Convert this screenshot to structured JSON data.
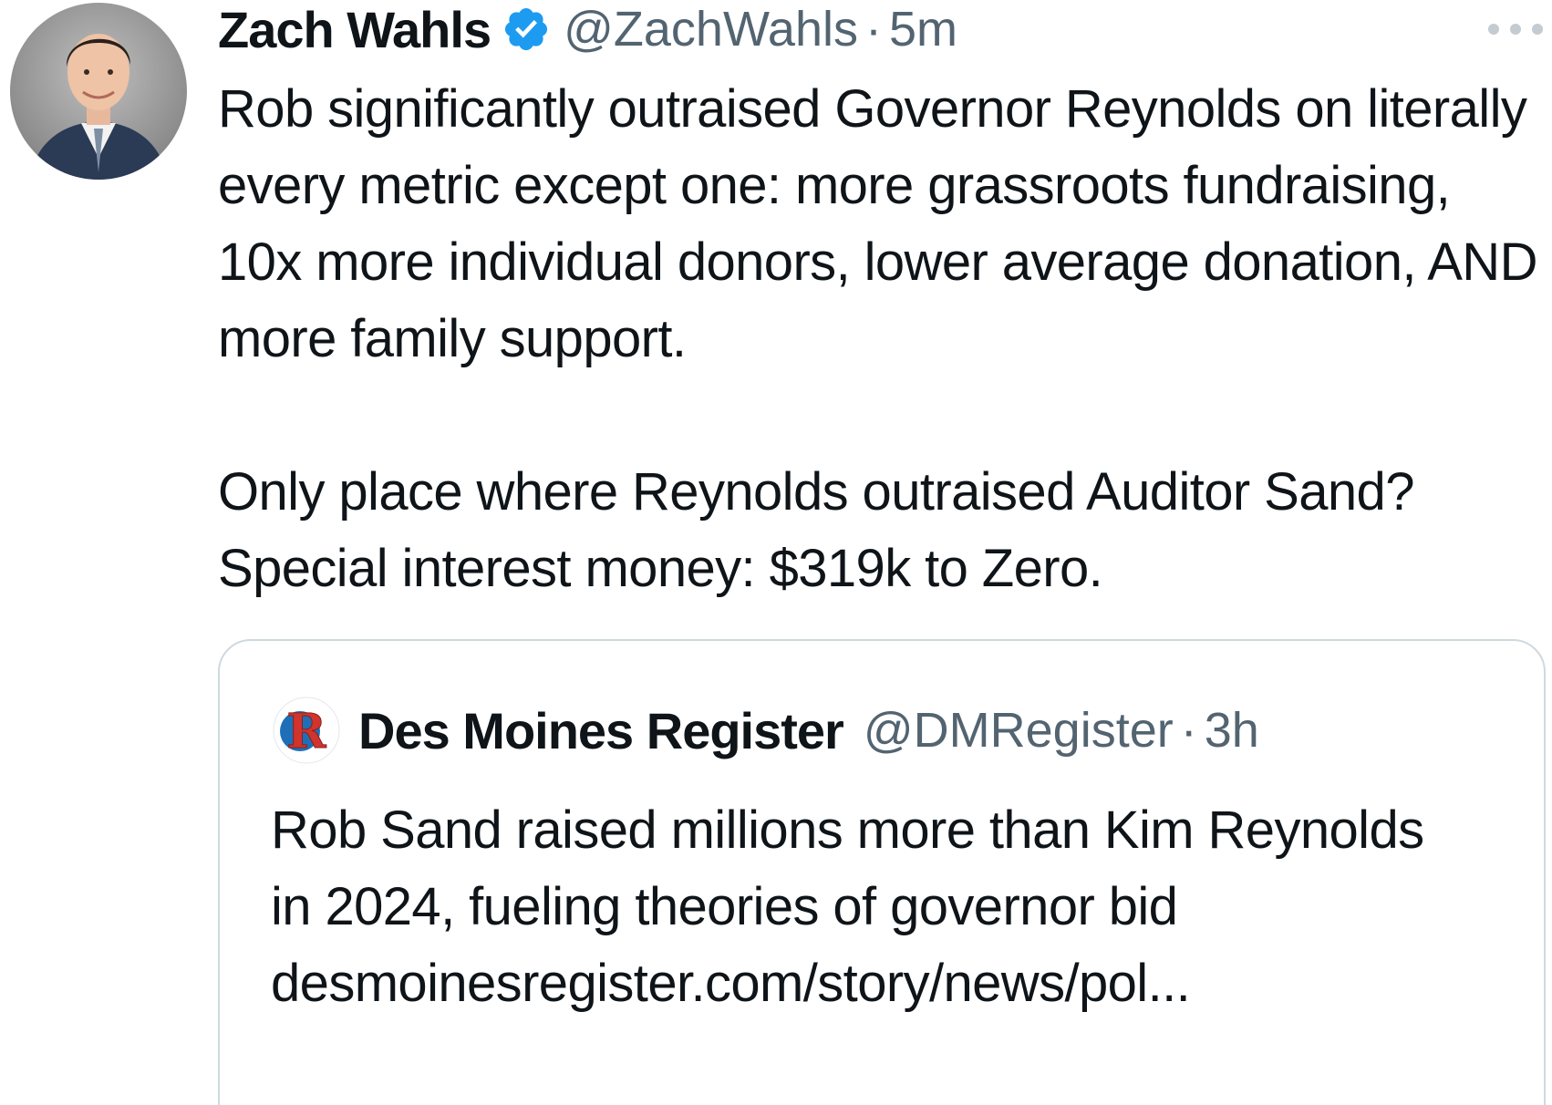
{
  "tweet": {
    "author": {
      "display_name": "Zach Wahls",
      "handle": "@ZachWahls",
      "time": "5m",
      "verified": true
    },
    "paragraphs": [
      "Rob significantly outraised Governor Reynolds on literally every metric except one: more grassroots fundraising, 10x more individual donors, lower average donation, AND more family support.",
      "Only place where Reynolds outraised Auditor Sand? Special interest money: $319k to Zero."
    ],
    "separator": "·"
  },
  "quoted_tweet": {
    "author": {
      "display_name": "Des Moines Register",
      "handle": "@DMRegister",
      "time": "3h"
    },
    "text": "Rob Sand raised millions more than Kim Reynolds in 2024, fueling theories of governor bid desmoinesregister.com/story/news/pol...",
    "separator": "·"
  },
  "colors": {
    "text": "#0f1419",
    "secondary_text": "#536471",
    "verified_badge": "#1d9bf0",
    "card_border": "#cfd9de"
  },
  "icons": {
    "verified": "verified-badge-icon",
    "more": "more-options-icon"
  }
}
